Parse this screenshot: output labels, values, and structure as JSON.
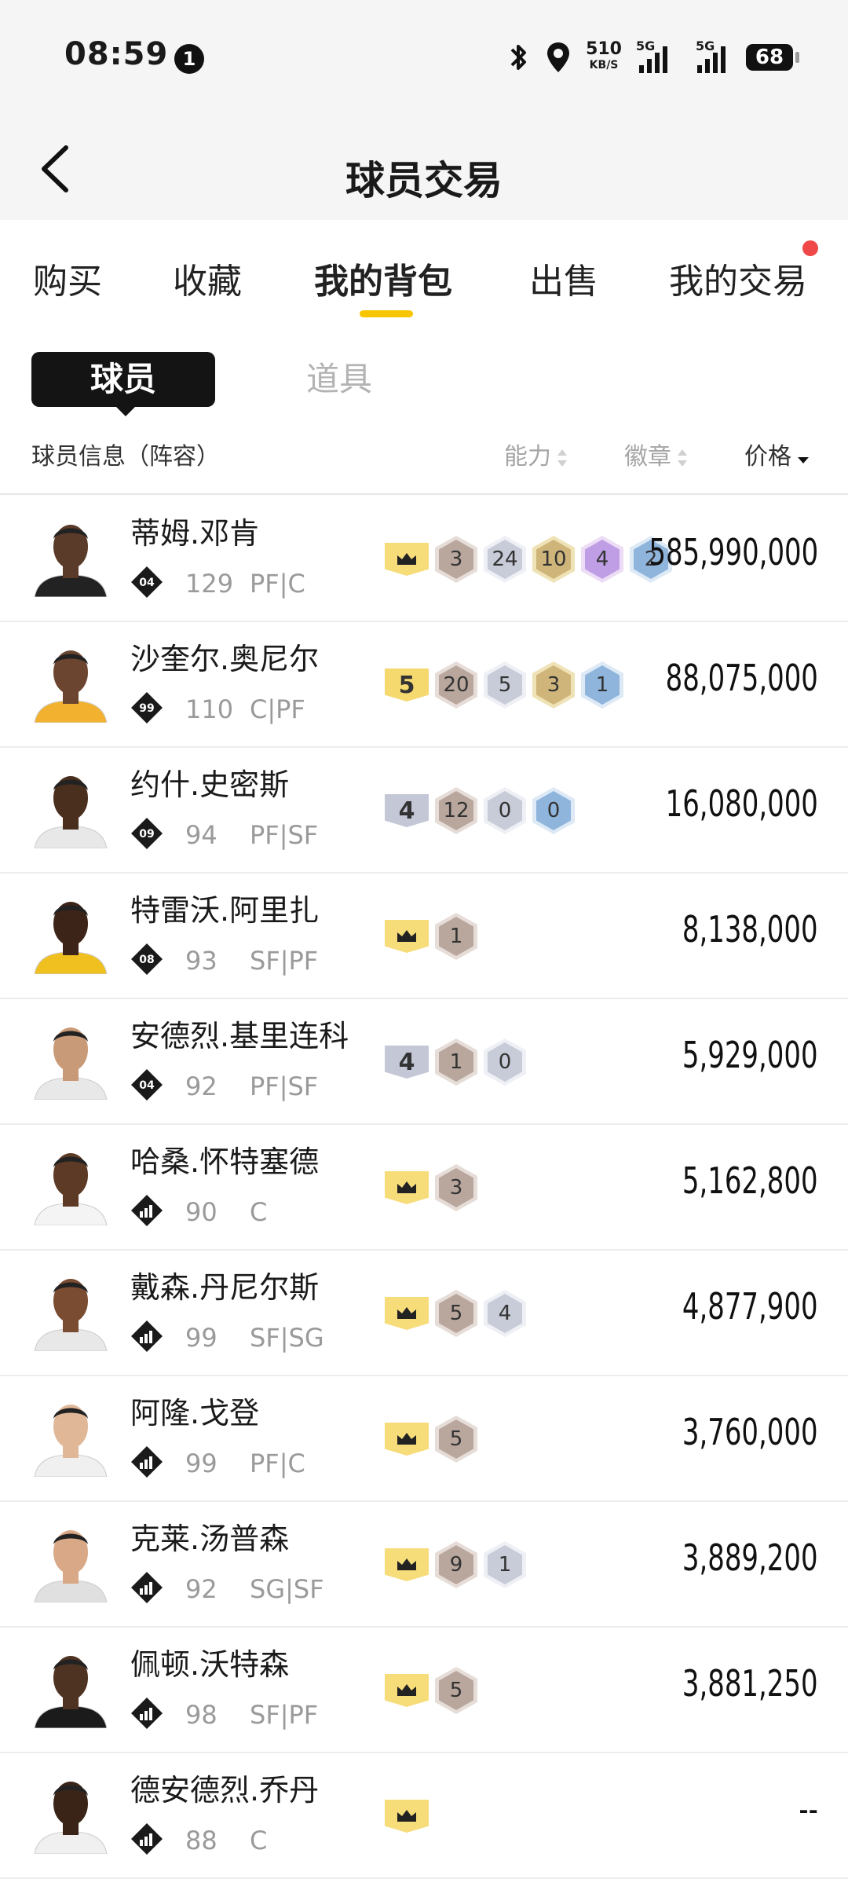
{
  "status_bar": {
    "time": "08:59",
    "notification_count": "1",
    "speed_value": "510",
    "speed_unit": "KB/S",
    "sig1_label": "5G",
    "sig2_label": "5G",
    "battery": "68"
  },
  "header": {
    "title": "球员交易"
  },
  "tabs": [
    {
      "label": "购买"
    },
    {
      "label": "收藏"
    },
    {
      "label": "我的背包"
    },
    {
      "label": "出售"
    },
    {
      "label": "我的交易"
    }
  ],
  "segment": {
    "active": "球员",
    "inactive": "道具"
  },
  "columns": {
    "info": "球员信息（阵容）",
    "ability": "能力",
    "badge": "徽章",
    "price": "价格"
  },
  "players": [
    {
      "name": "蒂姆.邓肯",
      "tier": "04",
      "rating": "129",
      "pos": "PF|C",
      "crown": true,
      "level": "",
      "badges": [
        {
          "v": "3",
          "c": "bronze"
        },
        {
          "v": "24",
          "c": "silver"
        },
        {
          "v": "10",
          "c": "gold"
        },
        {
          "v": "4",
          "c": "purple"
        },
        {
          "v": "2",
          "c": "blue"
        }
      ],
      "price": "585,990,000"
    },
    {
      "name": "沙奎尔.奥尼尔",
      "tier": "99",
      "rating": "110",
      "pos": "C|PF",
      "crown": false,
      "level": "5",
      "level_color": "gold",
      "badges": [
        {
          "v": "20",
          "c": "bronze"
        },
        {
          "v": "5",
          "c": "silver"
        },
        {
          "v": "3",
          "c": "gold"
        },
        {
          "v": "1",
          "c": "blue"
        }
      ],
      "price": "88,075,000"
    },
    {
      "name": "约什.史密斯",
      "tier": "09",
      "rating": "94",
      "pos": "PF|SF",
      "crown": false,
      "level": "4",
      "level_color": "gray",
      "badges": [
        {
          "v": "12",
          "c": "bronze"
        },
        {
          "v": "0",
          "c": "silver"
        },
        {
          "v": "0",
          "c": "blue"
        }
      ],
      "price": "16,080,000"
    },
    {
      "name": "特雷沃.阿里扎",
      "tier": "08",
      "rating": "93",
      "pos": "SF|PF",
      "crown": true,
      "level": "",
      "badges": [
        {
          "v": "1",
          "c": "bronze"
        }
      ],
      "price": "8,138,000"
    },
    {
      "name": "安德烈.基里连科",
      "tier": "04",
      "rating": "92",
      "pos": "PF|SF",
      "crown": false,
      "level": "4",
      "level_color": "gray",
      "badges": [
        {
          "v": "1",
          "c": "bronze"
        },
        {
          "v": "0",
          "c": "silver"
        }
      ],
      "price": "5,929,000"
    },
    {
      "name": "哈桑.怀特塞德",
      "tier": "bars",
      "rating": "90",
      "pos": "C",
      "crown": true,
      "level": "",
      "badges": [
        {
          "v": "3",
          "c": "bronze"
        }
      ],
      "price": "5,162,800"
    },
    {
      "name": "戴森.丹尼尔斯",
      "tier": "bars",
      "rating": "99",
      "pos": "SF|SG",
      "crown": true,
      "level": "",
      "badges": [
        {
          "v": "5",
          "c": "bronze"
        },
        {
          "v": "4",
          "c": "silver"
        }
      ],
      "price": "4,877,900"
    },
    {
      "name": "阿隆.戈登",
      "tier": "bars",
      "rating": "99",
      "pos": "PF|C",
      "crown": true,
      "level": "",
      "badges": [
        {
          "v": "5",
          "c": "bronze"
        }
      ],
      "price": "3,760,000"
    },
    {
      "name": "克莱.汤普森",
      "tier": "bars",
      "rating": "92",
      "pos": "SG|SF",
      "crown": true,
      "level": "",
      "badges": [
        {
          "v": "9",
          "c": "bronze"
        },
        {
          "v": "1",
          "c": "silver"
        }
      ],
      "price": "3,889,200"
    },
    {
      "name": "佩顿.沃特森",
      "tier": "bars",
      "rating": "98",
      "pos": "SF|PF",
      "crown": true,
      "level": "",
      "badges": [
        {
          "v": "5",
          "c": "bronze"
        }
      ],
      "price": "3,881,250"
    },
    {
      "name": "德安德烈.乔丹",
      "tier": "bars",
      "rating": "88",
      "pos": "C",
      "crown": true,
      "level": "",
      "badges": [],
      "price": "--"
    }
  ],
  "colors": {
    "accent": "#f7c600",
    "dot": "#f04848"
  }
}
